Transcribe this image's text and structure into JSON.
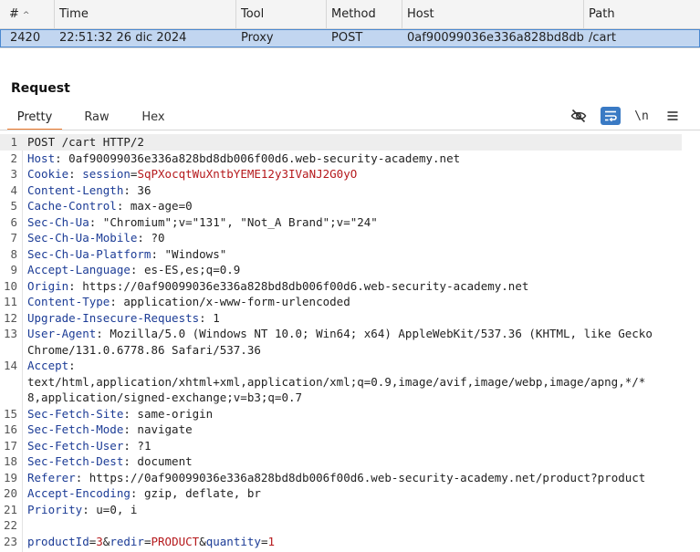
{
  "history": {
    "columns": [
      {
        "label": "#",
        "sort": "^"
      },
      {
        "label": "Time"
      },
      {
        "label": "Tool"
      },
      {
        "label": "Method"
      },
      {
        "label": "Host"
      },
      {
        "label": "Path"
      }
    ],
    "row": {
      "id": "2420",
      "time": "22:51:32 26 dic 2024",
      "tool": "Proxy",
      "method": "POST",
      "host": "0af90099036e336a828bd8db...",
      "path": "/cart"
    }
  },
  "request": {
    "title": "Request",
    "tabs": [
      "Pretty",
      "Raw",
      "Hex"
    ],
    "active_tab": "Pretty",
    "toolbar": {
      "newline_label": "\\n"
    }
  },
  "editor": {
    "lines": [
      {
        "n": "1",
        "plain": "POST /cart HTTP/2"
      },
      {
        "n": "2",
        "name": "Host",
        "value": " 0af90099036e336a828bd8db006f00d6.web-security-academy.net"
      },
      {
        "n": "3",
        "name": "Cookie",
        "value": " ",
        "cookie_name": "session",
        "cookie_value": "SqPXocqtWuXntbYEME12y3IVaNJ2G0yO"
      },
      {
        "n": "4",
        "name": "Content-Length",
        "value": " 36"
      },
      {
        "n": "5",
        "name": "Cache-Control",
        "value": " max-age=0"
      },
      {
        "n": "6",
        "name": "Sec-Ch-Ua",
        "value": " \"Chromium\";v=\"131\", \"Not_A Brand\";v=\"24\""
      },
      {
        "n": "7",
        "name": "Sec-Ch-Ua-Mobile",
        "value": " ?0"
      },
      {
        "n": "8",
        "name": "Sec-Ch-Ua-Platform",
        "value": " \"Windows\""
      },
      {
        "n": "9",
        "name": "Accept-Language",
        "value": " es-ES,es;q=0.9"
      },
      {
        "n": "10",
        "name": "Origin",
        "value": " https://0af90099036e336a828bd8db006f00d6.web-security-academy.net"
      },
      {
        "n": "11",
        "name": "Content-Type",
        "value": " application/x-www-form-urlencoded"
      },
      {
        "n": "12",
        "name": "Upgrade-Insecure-Requests",
        "value": " 1"
      },
      {
        "n": "13",
        "name": "User-Agent",
        "value": " Mozilla/5.0 (Windows NT 10.0; Win64; x64) AppleWebKit/537.36 (KHTML, like Gecko"
      },
      {
        "n": "",
        "plain": "Chrome/131.0.6778.86 Safari/537.36"
      },
      {
        "n": "14",
        "name": "Accept",
        "value": ""
      },
      {
        "n": "",
        "plain": "text/html,application/xhtml+xml,application/xml;q=0.9,image/avif,image/webp,image/apng,*/*"
      },
      {
        "n": "",
        "plain": "8,application/signed-exchange;v=b3;q=0.7"
      },
      {
        "n": "15",
        "name": "Sec-Fetch-Site",
        "value": " same-origin"
      },
      {
        "n": "16",
        "name": "Sec-Fetch-Mode",
        "value": " navigate"
      },
      {
        "n": "17",
        "name": "Sec-Fetch-User",
        "value": " ?1"
      },
      {
        "n": "18",
        "name": "Sec-Fetch-Dest",
        "value": " document"
      },
      {
        "n": "19",
        "name": "Referer",
        "value": " https://0af90099036e336a828bd8db006f00d6.web-security-academy.net/product?product"
      },
      {
        "n": "20",
        "name": "Accept-Encoding",
        "value": " gzip, deflate, br"
      },
      {
        "n": "21",
        "name": "Priority",
        "value": " u=0, i"
      },
      {
        "n": "22",
        "plain": ""
      },
      {
        "n": "23",
        "body": [
          {
            "k": "productId",
            "v": "3"
          },
          {
            "k": "redir",
            "v": "PRODUCT"
          },
          {
            "k": "quantity",
            "v": "1"
          }
        ]
      }
    ]
  },
  "colors": {
    "header_name": "#1c3c96",
    "param_value": "#b5191c",
    "selected_row": "#c2d6f0",
    "active_tab_underline": "#ee7a2c",
    "toggle_on": "#3a7ac4"
  },
  "icons": [
    "eye-off-icon",
    "word-wrap-icon",
    "newline-icon",
    "hamburger-menu-icon"
  ]
}
